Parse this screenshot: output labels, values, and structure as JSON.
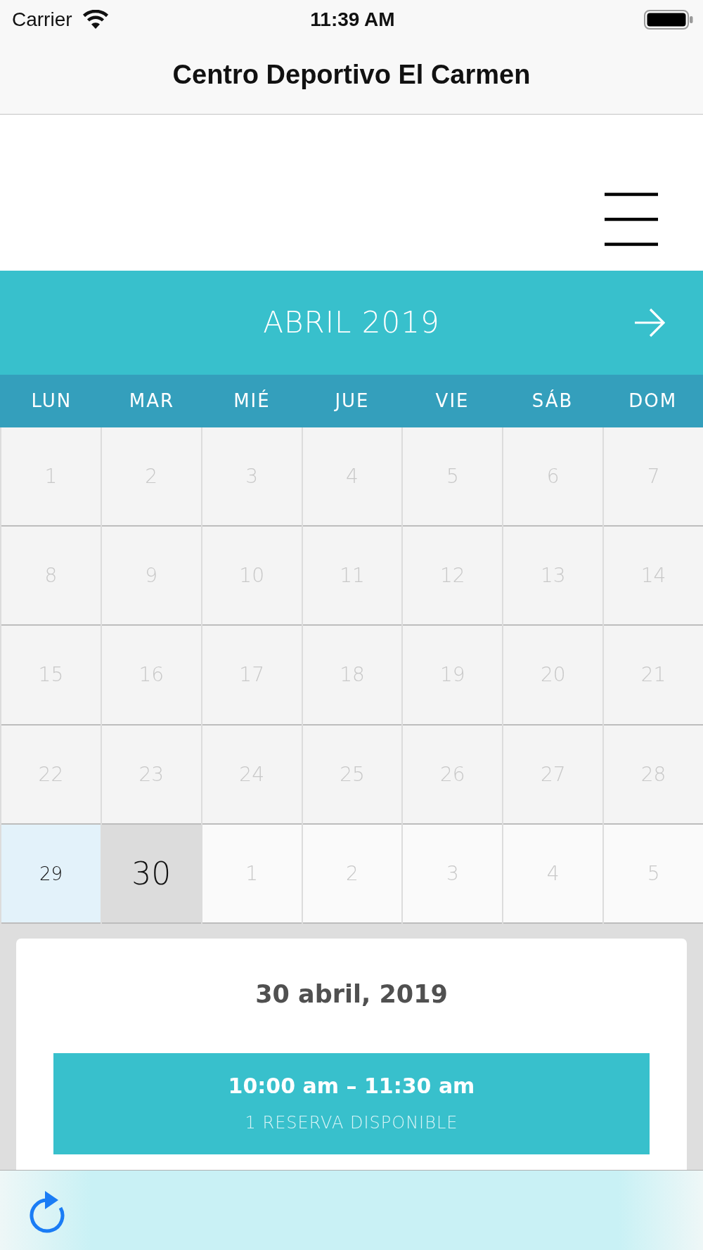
{
  "status_bar": {
    "carrier": "Carrier",
    "time": "11:39 AM"
  },
  "nav_bar": {
    "title": "Centro Deportivo El Carmen"
  },
  "calendar": {
    "month": "ABRIL 2019",
    "weekdays": [
      "LUN",
      "MAR",
      "MIÉ",
      "JUE",
      "VIE",
      "SÁB",
      "DOM"
    ],
    "days": [
      {
        "label": "1",
        "kind": "past",
        "selected": false
      },
      {
        "label": "2",
        "kind": "past",
        "selected": false
      },
      {
        "label": "3",
        "kind": "past",
        "selected": false
      },
      {
        "label": "4",
        "kind": "past",
        "selected": false
      },
      {
        "label": "5",
        "kind": "past",
        "selected": false
      },
      {
        "label": "6",
        "kind": "past",
        "selected": false
      },
      {
        "label": "7",
        "kind": "past",
        "selected": false
      },
      {
        "label": "8",
        "kind": "past",
        "selected": false
      },
      {
        "label": "9",
        "kind": "past",
        "selected": false
      },
      {
        "label": "10",
        "kind": "past",
        "selected": false
      },
      {
        "label": "11",
        "kind": "past",
        "selected": false
      },
      {
        "label": "12",
        "kind": "past",
        "selected": false
      },
      {
        "label": "13",
        "kind": "past",
        "selected": false
      },
      {
        "label": "14",
        "kind": "past",
        "selected": false
      },
      {
        "label": "15",
        "kind": "past",
        "selected": false
      },
      {
        "label": "16",
        "kind": "past",
        "selected": false
      },
      {
        "label": "17",
        "kind": "past",
        "selected": false
      },
      {
        "label": "18",
        "kind": "past",
        "selected": false
      },
      {
        "label": "19",
        "kind": "past",
        "selected": false
      },
      {
        "label": "20",
        "kind": "past",
        "selected": false
      },
      {
        "label": "21",
        "kind": "past",
        "selected": false
      },
      {
        "label": "22",
        "kind": "past",
        "selected": false
      },
      {
        "label": "23",
        "kind": "past",
        "selected": false
      },
      {
        "label": "24",
        "kind": "past",
        "selected": false
      },
      {
        "label": "25",
        "kind": "past",
        "selected": false
      },
      {
        "label": "26",
        "kind": "past",
        "selected": false
      },
      {
        "label": "27",
        "kind": "past",
        "selected": false
      },
      {
        "label": "28",
        "kind": "past",
        "selected": false
      },
      {
        "label": "29",
        "kind": "today",
        "selected": false
      },
      {
        "label": "30",
        "kind": "open",
        "selected": true
      },
      {
        "label": "1",
        "kind": "other_month",
        "selected": false
      },
      {
        "label": "2",
        "kind": "other_month",
        "selected": false
      },
      {
        "label": "3",
        "kind": "other_month",
        "selected": false
      },
      {
        "label": "4",
        "kind": "other_month",
        "selected": false
      },
      {
        "label": "5",
        "kind": "other_month",
        "selected": false
      }
    ]
  },
  "day_detail": {
    "date": "30 abril, 2019",
    "slots": [
      {
        "time": "10:00 am – 11:30 am",
        "availability": "1 RESERVA DISPONIBLE"
      }
    ]
  }
}
